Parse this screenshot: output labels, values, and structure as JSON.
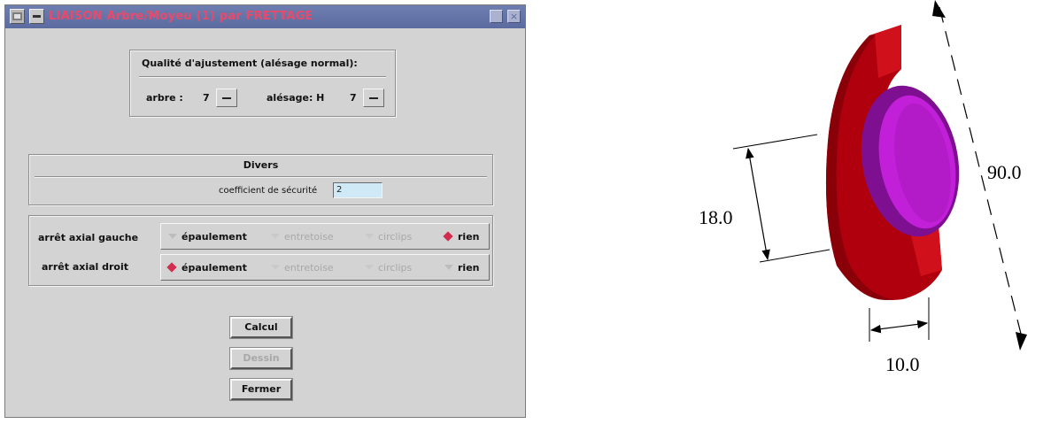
{
  "window": {
    "title": "LIAISON Arbre/Moyeu (1) par FRETTAGE",
    "close_glyph": "×"
  },
  "ajustement": {
    "heading": "Qualité d'ajustement (alésage normal):",
    "arbre_label": "arbre :",
    "arbre_value": "7",
    "alesage_label": "alésage: H",
    "alesage_value": "7"
  },
  "divers": {
    "heading": "Divers",
    "coef_label": "coefficient de sécurité",
    "coef_value": "2"
  },
  "arrets": {
    "rows": [
      {
        "label": "arrêt axial gauche",
        "options": [
          {
            "label": "épaulement",
            "selected": false,
            "enabled": true
          },
          {
            "label": "entretoise",
            "selected": false,
            "enabled": false
          },
          {
            "label": "circlips",
            "selected": false,
            "enabled": false
          },
          {
            "label": "rien",
            "selected": true,
            "enabled": true
          }
        ]
      },
      {
        "label": "arrêt axial droit",
        "options": [
          {
            "label": "épaulement",
            "selected": true,
            "enabled": true
          },
          {
            "label": "entretoise",
            "selected": false,
            "enabled": false
          },
          {
            "label": "circlips",
            "selected": false,
            "enabled": false
          },
          {
            "label": "rien",
            "selected": false,
            "enabled": true
          }
        ]
      }
    ]
  },
  "buttons": {
    "calcul": "Calcul",
    "dessin": "Dessin",
    "fermer": "Fermer"
  },
  "drawing": {
    "dim_diameter": "18.0",
    "dim_length": "90.0",
    "dim_width": "10.0",
    "colors": {
      "hub": "#b0000d",
      "hub_dark": "#7a0008",
      "shaft": "#c21fd8",
      "shaft_dark": "#8a0fa0"
    }
  }
}
